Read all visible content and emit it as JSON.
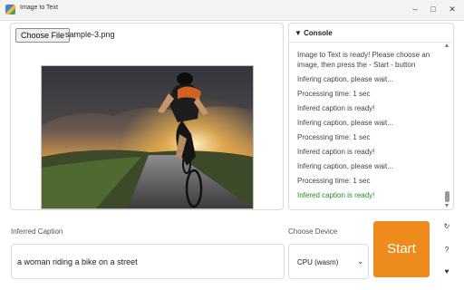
{
  "window": {
    "title": "Image to Text",
    "controls": [
      "–",
      "□",
      "✕"
    ]
  },
  "file": {
    "button_label": "Choose File",
    "file_name": "sample-3.png"
  },
  "console": {
    "header": "▼ Console",
    "lines": [
      {
        "text": "Image to Text is ready! Please choose an image, then press the - Start - button",
        "status": "info"
      },
      {
        "text": "Infering caption, please wait...",
        "status": "info"
      },
      {
        "text": "Processing time: 1 sec",
        "status": "info"
      },
      {
        "text": "Infered caption is ready!",
        "status": "info"
      },
      {
        "text": "Infering caption, please wait...",
        "status": "info"
      },
      {
        "text": "Processing time: 1 sec",
        "status": "info"
      },
      {
        "text": "Infered caption is ready!",
        "status": "info"
      },
      {
        "text": "Infering caption, please wait...",
        "status": "info"
      },
      {
        "text": "Processing time: 1 sec",
        "status": "info"
      },
      {
        "text": "Infered caption is ready!",
        "status": "success"
      }
    ]
  },
  "caption": {
    "label": "Inferred Caption",
    "value": "a woman riding a bike on a street"
  },
  "device": {
    "label": "Choose Device",
    "selected": "CPU (wasm)"
  },
  "start": {
    "label": "Start"
  },
  "side_icons": [
    {
      "icon": "refresh-icon",
      "glyph": "↻"
    },
    {
      "icon": "help-icon",
      "glyph": "?"
    },
    {
      "icon": "heart-icon",
      "glyph": "♥"
    }
  ],
  "colors": {
    "accent": "#ed8c1c",
    "success": "#2a8a2a"
  }
}
